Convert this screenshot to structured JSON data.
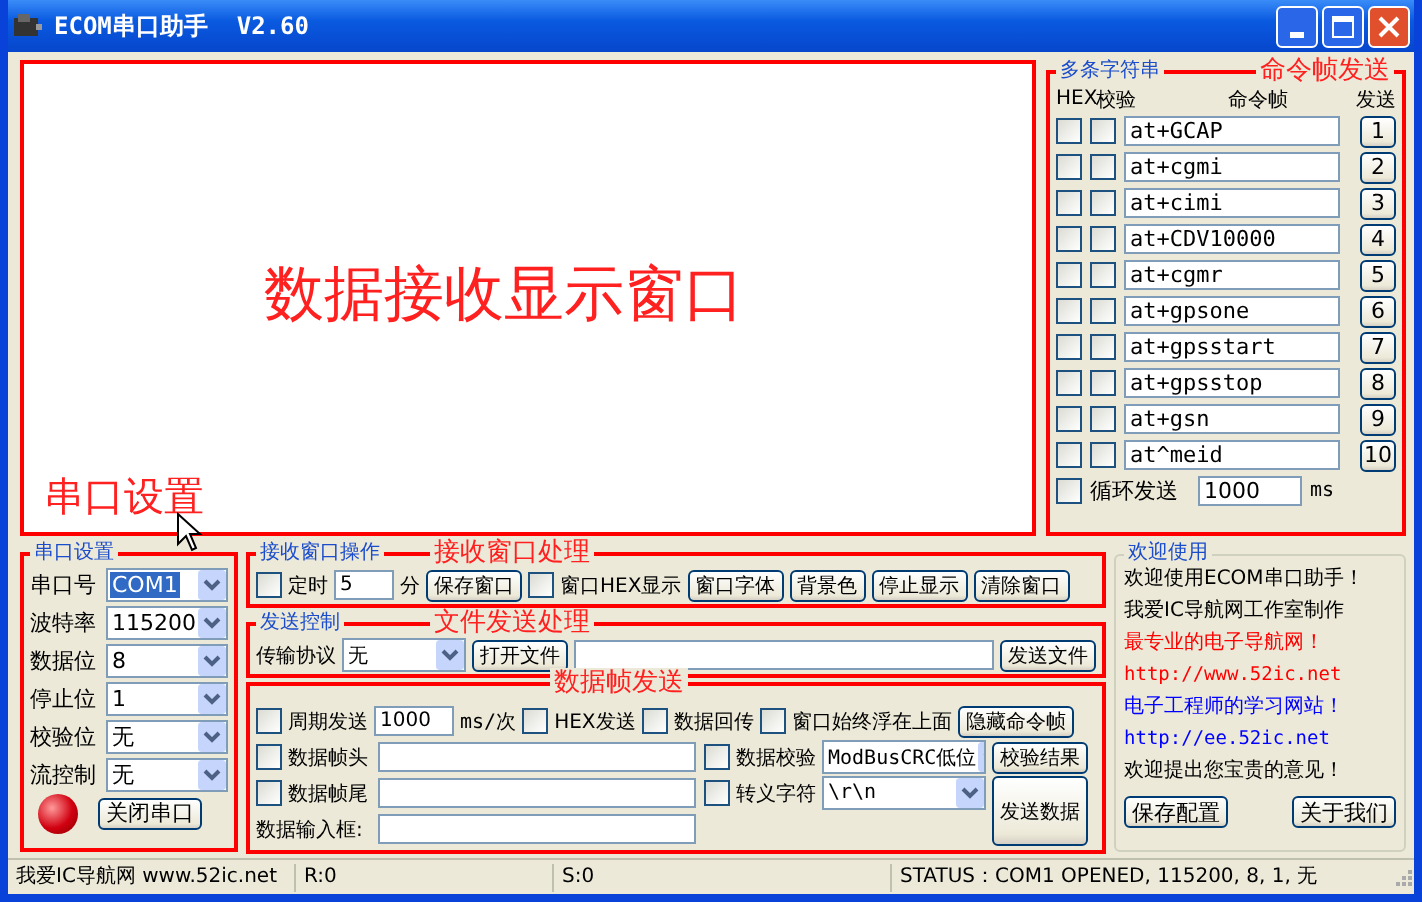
{
  "window": {
    "title": "ECOM串口助手  V2.60"
  },
  "receive_window": {
    "annotation": "数据接收显示窗口"
  },
  "multi_string": {
    "title": "多条字符串",
    "annotation": "命令帧发送",
    "headers": [
      "HEX",
      "校验",
      "命令帧",
      "发送"
    ],
    "rows": [
      {
        "hex": false,
        "check": false,
        "command": "at+GCAP",
        "button": "1"
      },
      {
        "hex": false,
        "check": false,
        "command": "at+cgmi",
        "button": "2"
      },
      {
        "hex": false,
        "check": false,
        "command": "at+cimi",
        "button": "3"
      },
      {
        "hex": false,
        "check": false,
        "command": "at+CDV10000",
        "button": "4"
      },
      {
        "hex": false,
        "check": false,
        "command": "at+cgmr",
        "button": "5"
      },
      {
        "hex": false,
        "check": false,
        "command": "at+gpsone",
        "button": "6"
      },
      {
        "hex": false,
        "check": false,
        "command": "at+gpsstart",
        "button": "7"
      },
      {
        "hex": false,
        "check": false,
        "command": "at+gpsstop",
        "button": "8"
      },
      {
        "hex": false,
        "check": false,
        "command": "at+gsn",
        "button": "9"
      },
      {
        "hex": false,
        "check": false,
        "command": "at^meid",
        "button": "10"
      }
    ],
    "loop": {
      "label": "循环发送",
      "checked": false,
      "value": "1000",
      "unit": "ms"
    }
  },
  "serial": {
    "title": "串口设置",
    "annotation": "串口设置",
    "fields": [
      {
        "label": "串口号",
        "value": "COM1",
        "focused": true
      },
      {
        "label": "波特率",
        "value": "115200",
        "focused": false
      },
      {
        "label": "数据位",
        "value": "8",
        "focused": false
      },
      {
        "label": "停止位",
        "value": "1",
        "focused": false
      },
      {
        "label": "校验位",
        "value": "无",
        "focused": false
      },
      {
        "label": "流控制",
        "value": "无",
        "focused": false
      }
    ],
    "button": "关闭串口"
  },
  "receive_ops": {
    "title": "接收窗口操作",
    "annotation": "接收窗口处理",
    "timer": {
      "label": "定时",
      "checked": false,
      "value": "5",
      "unit": "分"
    },
    "items": [
      {
        "kind": "button",
        "label": "保存窗口"
      },
      {
        "kind": "checkbox",
        "label": "窗口HEX显示",
        "checked": false
      },
      {
        "kind": "button",
        "label": "窗口字体"
      },
      {
        "kind": "button",
        "label": "背景色"
      },
      {
        "kind": "button",
        "label": "停止显示"
      },
      {
        "kind": "button",
        "label": "清除窗口"
      }
    ]
  },
  "send_control": {
    "title": "发送控制",
    "annotation": "文件发送处理",
    "protocol_label": "传输协议",
    "protocol": "无",
    "open_button": "打开文件",
    "send_button": "发送文件"
  },
  "data_send": {
    "annotation": "数据帧发送",
    "period": {
      "label": "周期发送",
      "checked": false,
      "value": "1000",
      "unit": "ms/次"
    },
    "options": [
      {
        "label": "HEX发送",
        "checked": false
      },
      {
        "label": "数据回传",
        "checked": false
      },
      {
        "label": "窗口始终浮在上面",
        "checked": false
      }
    ],
    "hide_button": "隐藏命令帧",
    "header": {
      "label": "数据帧头",
      "checked": false
    },
    "trailer": {
      "label": "数据帧尾",
      "checked": false
    },
    "checksum": {
      "label": "数据校验",
      "checked": false,
      "value": "ModBusCRC低位"
    },
    "check_result": "校验结果",
    "escape": {
      "label": "转义字符",
      "checked": false,
      "value": "\\r\\n"
    },
    "input_label": "数据输入框:",
    "send_button": "发送数据"
  },
  "welcome": {
    "title": "欢迎使用",
    "lines": [
      {
        "kind": "text",
        "text": "欢迎使用ECOM串口助手！",
        "color": "#000000"
      },
      {
        "kind": "text",
        "text": "我爱IC导航网工作室制作",
        "color": "#000000"
      },
      {
        "kind": "text",
        "text": "最专业的电子导航网！",
        "color": "#ff0000"
      },
      {
        "kind": "link",
        "text": "http://www.52ic.net",
        "color": "#ff0000"
      },
      {
        "kind": "text",
        "text": "电子工程师的学习网站！",
        "color": "#0000ff"
      },
      {
        "kind": "link",
        "text": "http://ee.52ic.net",
        "color": "#0000ff"
      },
      {
        "kind": "text",
        "text": "欢迎提出您宝贵的意见！",
        "color": "#000000"
      }
    ],
    "buttons": [
      "保存配置",
      "关于我们"
    ]
  },
  "status_bar": [
    "我爱IC导航网 www.52ic.net",
    "R:0",
    "S:0",
    "STATUS：COM1 OPENED, 115200, 8, 1, 无"
  ]
}
